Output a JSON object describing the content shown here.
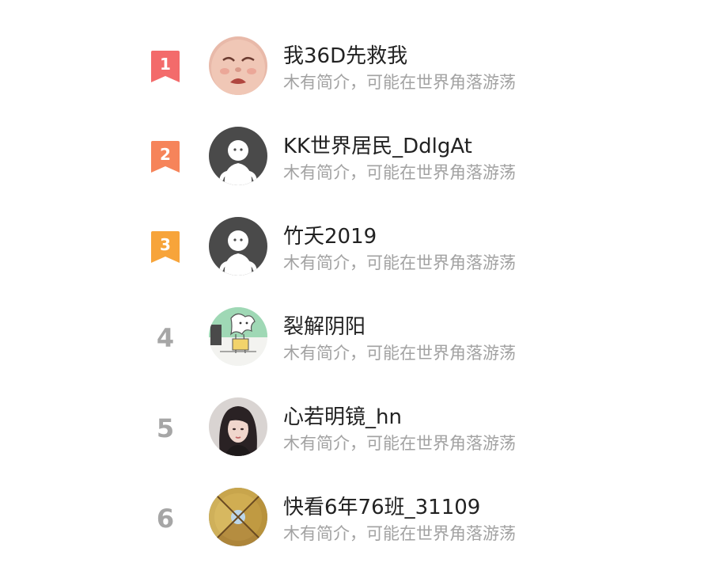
{
  "colors": {
    "rank1": "#f36b6b",
    "rank2": "#f6845a",
    "rank3": "#f7a43a",
    "rank_plain": "#a6a6a6",
    "name": "#222222",
    "bio": "#a2a2a2"
  },
  "users": [
    {
      "rank": "1",
      "name": "我36D先救我",
      "bio": "木有简介，可能在世界角落游荡",
      "avatar": "crying-face-avatar"
    },
    {
      "rank": "2",
      "name": "KK世界居民_DdlgAt",
      "bio": "木有简介，可能在世界角落游荡",
      "avatar": "default-avatar"
    },
    {
      "rank": "3",
      "name": "竹夭2019",
      "bio": "木有简介，可能在世界角落游荡",
      "avatar": "default-avatar"
    },
    {
      "rank": "4",
      "name": "裂解阴阳",
      "bio": "木有简介，可能在世界角落游荡",
      "avatar": "cartoon-dragon-avatar"
    },
    {
      "rank": "5",
      "name": "心若明镜_hn",
      "bio": "木有简介，可能在世界角落游荡",
      "avatar": "portrait-photo-avatar"
    },
    {
      "rank": "6",
      "name": "快看6年76班_31109",
      "bio": "木有简介，可能在世界角落游荡",
      "avatar": "autumn-trees-avatar"
    }
  ]
}
